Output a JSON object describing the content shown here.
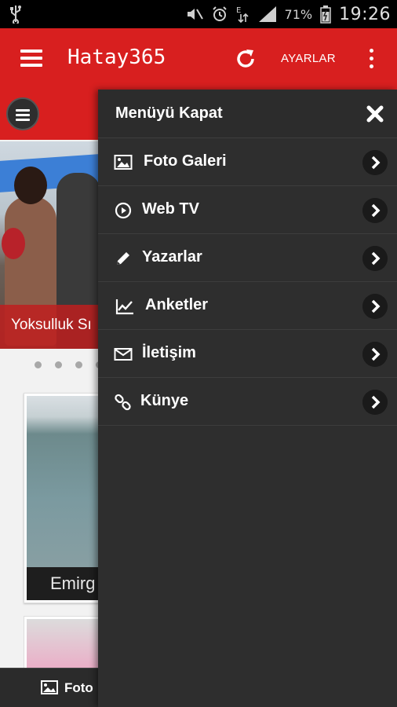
{
  "status_bar": {
    "battery_percent": "71%",
    "time": "19:26"
  },
  "app_bar": {
    "title": "Hatay365",
    "settings_label": "AYARLAR"
  },
  "background": {
    "slider_caption": "Yoksulluk Sı",
    "card1_caption": "Emirg",
    "bottom_tab_label": "Foto"
  },
  "drawer": {
    "close_label": "Menüyü Kapat",
    "items": [
      {
        "label": "Foto Galeri",
        "icon": "image-icon"
      },
      {
        "label": "Web TV",
        "icon": "play-circle-icon"
      },
      {
        "label": "Yazarlar",
        "icon": "pencil-icon"
      },
      {
        "label": "Anketler",
        "icon": "line-chart-icon"
      },
      {
        "label": "İletişim",
        "icon": "envelope-icon"
      },
      {
        "label": "Künye",
        "icon": "link-icon"
      }
    ]
  },
  "colors": {
    "brand_red": "#d81f1f",
    "drawer_bg": "#2e2e2e"
  }
}
